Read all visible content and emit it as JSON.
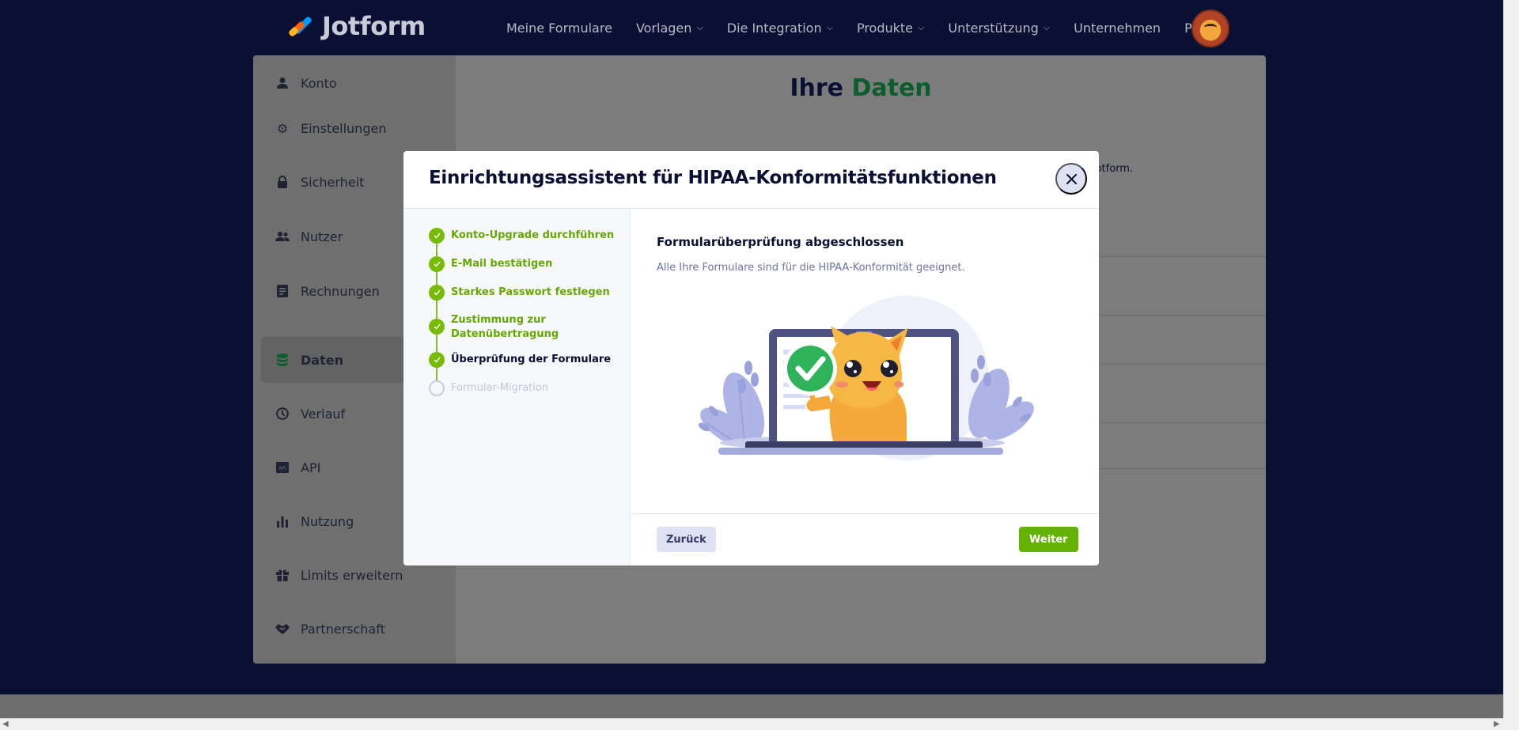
{
  "brand": {
    "name": "Jotform"
  },
  "nav": {
    "items": [
      {
        "label": "Meine Formulare",
        "dropdown": false
      },
      {
        "label": "Vorlagen",
        "dropdown": true
      },
      {
        "label": "Die Integration",
        "dropdown": true
      },
      {
        "label": "Produkte",
        "dropdown": true
      },
      {
        "label": "Unterstützung",
        "dropdown": true
      },
      {
        "label": "Unternehmen",
        "dropdown": false
      },
      {
        "label": "Preise",
        "dropdown": false
      }
    ]
  },
  "sidebar": {
    "items": [
      {
        "label": "Konto",
        "icon": "user-icon",
        "active": false
      },
      {
        "label": "Einstellungen",
        "icon": "gear-icon",
        "active": false
      },
      {
        "label": "Sicherheit",
        "icon": "lock-icon",
        "active": false
      },
      {
        "label": "Nutzer",
        "icon": "users-icon",
        "active": false
      },
      {
        "label": "Rechnungen",
        "icon": "invoice-icon",
        "active": false
      },
      {
        "label": "Daten",
        "icon": "database-icon",
        "active": true
      },
      {
        "label": "Verlauf",
        "icon": "clock-icon",
        "active": false
      },
      {
        "label": "API",
        "icon": "api-icon",
        "active": false
      },
      {
        "label": "Nutzung",
        "icon": "bar-chart-icon",
        "active": false
      },
      {
        "label": "Limits erweitern",
        "icon": "gift-icon",
        "active": false
      },
      {
        "label": "Partnerschaft",
        "icon": "handshake-icon",
        "active": false
      }
    ]
  },
  "background_page": {
    "title_part1": "Ihre",
    "title_part2": "Daten",
    "description_fragment": "-Funktionen von Jotform."
  },
  "modal": {
    "title": "Einrichtungsassistent für HIPAA-Konformitätsfunktionen",
    "steps": [
      {
        "label": "Konto-Upgrade durchführen",
        "status": "done"
      },
      {
        "label": "E-Mail bestätigen",
        "status": "done"
      },
      {
        "label": "Starkes Passwort festlegen",
        "status": "done"
      },
      {
        "label": "Zustimmung zur Datenübertragung",
        "status": "done"
      },
      {
        "label": "Überprüfung der Formulare",
        "status": "current"
      },
      {
        "label": "Formular-Migration",
        "status": "pending"
      }
    ],
    "content_title": "Formularüberprüfung abgeschlossen",
    "content_text": "Alle Ihre Formulare sind für die HIPAA-Konformität geeignet.",
    "back_label": "Zurück",
    "next_label": "Weiter"
  },
  "colors": {
    "accent_green": "#64b200",
    "navy": "#0a1033",
    "step_green": "#78bb07"
  }
}
